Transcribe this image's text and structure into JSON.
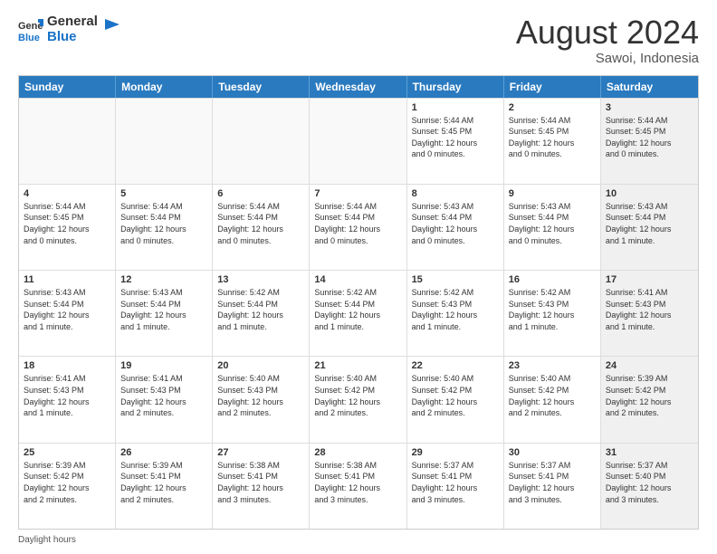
{
  "header": {
    "logo_general": "General",
    "logo_blue": "Blue",
    "month_title": "August 2024",
    "location": "Sawoi, Indonesia"
  },
  "weekdays": [
    "Sunday",
    "Monday",
    "Tuesday",
    "Wednesday",
    "Thursday",
    "Friday",
    "Saturday"
  ],
  "rows": [
    [
      {
        "day": "",
        "text": "",
        "empty": true
      },
      {
        "day": "",
        "text": "",
        "empty": true
      },
      {
        "day": "",
        "text": "",
        "empty": true
      },
      {
        "day": "",
        "text": "",
        "empty": true
      },
      {
        "day": "1",
        "text": "Sunrise: 5:44 AM\nSunset: 5:45 PM\nDaylight: 12 hours\nand 0 minutes.",
        "empty": false
      },
      {
        "day": "2",
        "text": "Sunrise: 5:44 AM\nSunset: 5:45 PM\nDaylight: 12 hours\nand 0 minutes.",
        "empty": false
      },
      {
        "day": "3",
        "text": "Sunrise: 5:44 AM\nSunset: 5:45 PM\nDaylight: 12 hours\nand 0 minutes.",
        "empty": false,
        "shaded": true
      }
    ],
    [
      {
        "day": "4",
        "text": "Sunrise: 5:44 AM\nSunset: 5:45 PM\nDaylight: 12 hours\nand 0 minutes.",
        "empty": false
      },
      {
        "day": "5",
        "text": "Sunrise: 5:44 AM\nSunset: 5:44 PM\nDaylight: 12 hours\nand 0 minutes.",
        "empty": false
      },
      {
        "day": "6",
        "text": "Sunrise: 5:44 AM\nSunset: 5:44 PM\nDaylight: 12 hours\nand 0 minutes.",
        "empty": false
      },
      {
        "day": "7",
        "text": "Sunrise: 5:44 AM\nSunset: 5:44 PM\nDaylight: 12 hours\nand 0 minutes.",
        "empty": false
      },
      {
        "day": "8",
        "text": "Sunrise: 5:43 AM\nSunset: 5:44 PM\nDaylight: 12 hours\nand 0 minutes.",
        "empty": false
      },
      {
        "day": "9",
        "text": "Sunrise: 5:43 AM\nSunset: 5:44 PM\nDaylight: 12 hours\nand 0 minutes.",
        "empty": false
      },
      {
        "day": "10",
        "text": "Sunrise: 5:43 AM\nSunset: 5:44 PM\nDaylight: 12 hours\nand 1 minute.",
        "empty": false,
        "shaded": true
      }
    ],
    [
      {
        "day": "11",
        "text": "Sunrise: 5:43 AM\nSunset: 5:44 PM\nDaylight: 12 hours\nand 1 minute.",
        "empty": false
      },
      {
        "day": "12",
        "text": "Sunrise: 5:43 AM\nSunset: 5:44 PM\nDaylight: 12 hours\nand 1 minute.",
        "empty": false
      },
      {
        "day": "13",
        "text": "Sunrise: 5:42 AM\nSunset: 5:44 PM\nDaylight: 12 hours\nand 1 minute.",
        "empty": false
      },
      {
        "day": "14",
        "text": "Sunrise: 5:42 AM\nSunset: 5:44 PM\nDaylight: 12 hours\nand 1 minute.",
        "empty": false
      },
      {
        "day": "15",
        "text": "Sunrise: 5:42 AM\nSunset: 5:43 PM\nDaylight: 12 hours\nand 1 minute.",
        "empty": false
      },
      {
        "day": "16",
        "text": "Sunrise: 5:42 AM\nSunset: 5:43 PM\nDaylight: 12 hours\nand 1 minute.",
        "empty": false
      },
      {
        "day": "17",
        "text": "Sunrise: 5:41 AM\nSunset: 5:43 PM\nDaylight: 12 hours\nand 1 minute.",
        "empty": false,
        "shaded": true
      }
    ],
    [
      {
        "day": "18",
        "text": "Sunrise: 5:41 AM\nSunset: 5:43 PM\nDaylight: 12 hours\nand 1 minute.",
        "empty": false
      },
      {
        "day": "19",
        "text": "Sunrise: 5:41 AM\nSunset: 5:43 PM\nDaylight: 12 hours\nand 2 minutes.",
        "empty": false
      },
      {
        "day": "20",
        "text": "Sunrise: 5:40 AM\nSunset: 5:43 PM\nDaylight: 12 hours\nand 2 minutes.",
        "empty": false
      },
      {
        "day": "21",
        "text": "Sunrise: 5:40 AM\nSunset: 5:42 PM\nDaylight: 12 hours\nand 2 minutes.",
        "empty": false
      },
      {
        "day": "22",
        "text": "Sunrise: 5:40 AM\nSunset: 5:42 PM\nDaylight: 12 hours\nand 2 minutes.",
        "empty": false
      },
      {
        "day": "23",
        "text": "Sunrise: 5:40 AM\nSunset: 5:42 PM\nDaylight: 12 hours\nand 2 minutes.",
        "empty": false
      },
      {
        "day": "24",
        "text": "Sunrise: 5:39 AM\nSunset: 5:42 PM\nDaylight: 12 hours\nand 2 minutes.",
        "empty": false,
        "shaded": true
      }
    ],
    [
      {
        "day": "25",
        "text": "Sunrise: 5:39 AM\nSunset: 5:42 PM\nDaylight: 12 hours\nand 2 minutes.",
        "empty": false
      },
      {
        "day": "26",
        "text": "Sunrise: 5:39 AM\nSunset: 5:41 PM\nDaylight: 12 hours\nand 2 minutes.",
        "empty": false
      },
      {
        "day": "27",
        "text": "Sunrise: 5:38 AM\nSunset: 5:41 PM\nDaylight: 12 hours\nand 3 minutes.",
        "empty": false
      },
      {
        "day": "28",
        "text": "Sunrise: 5:38 AM\nSunset: 5:41 PM\nDaylight: 12 hours\nand 3 minutes.",
        "empty": false
      },
      {
        "day": "29",
        "text": "Sunrise: 5:37 AM\nSunset: 5:41 PM\nDaylight: 12 hours\nand 3 minutes.",
        "empty": false
      },
      {
        "day": "30",
        "text": "Sunrise: 5:37 AM\nSunset: 5:41 PM\nDaylight: 12 hours\nand 3 minutes.",
        "empty": false
      },
      {
        "day": "31",
        "text": "Sunrise: 5:37 AM\nSunset: 5:40 PM\nDaylight: 12 hours\nand 3 minutes.",
        "empty": false,
        "shaded": true
      }
    ]
  ],
  "footer": {
    "daylight_label": "Daylight hours"
  }
}
